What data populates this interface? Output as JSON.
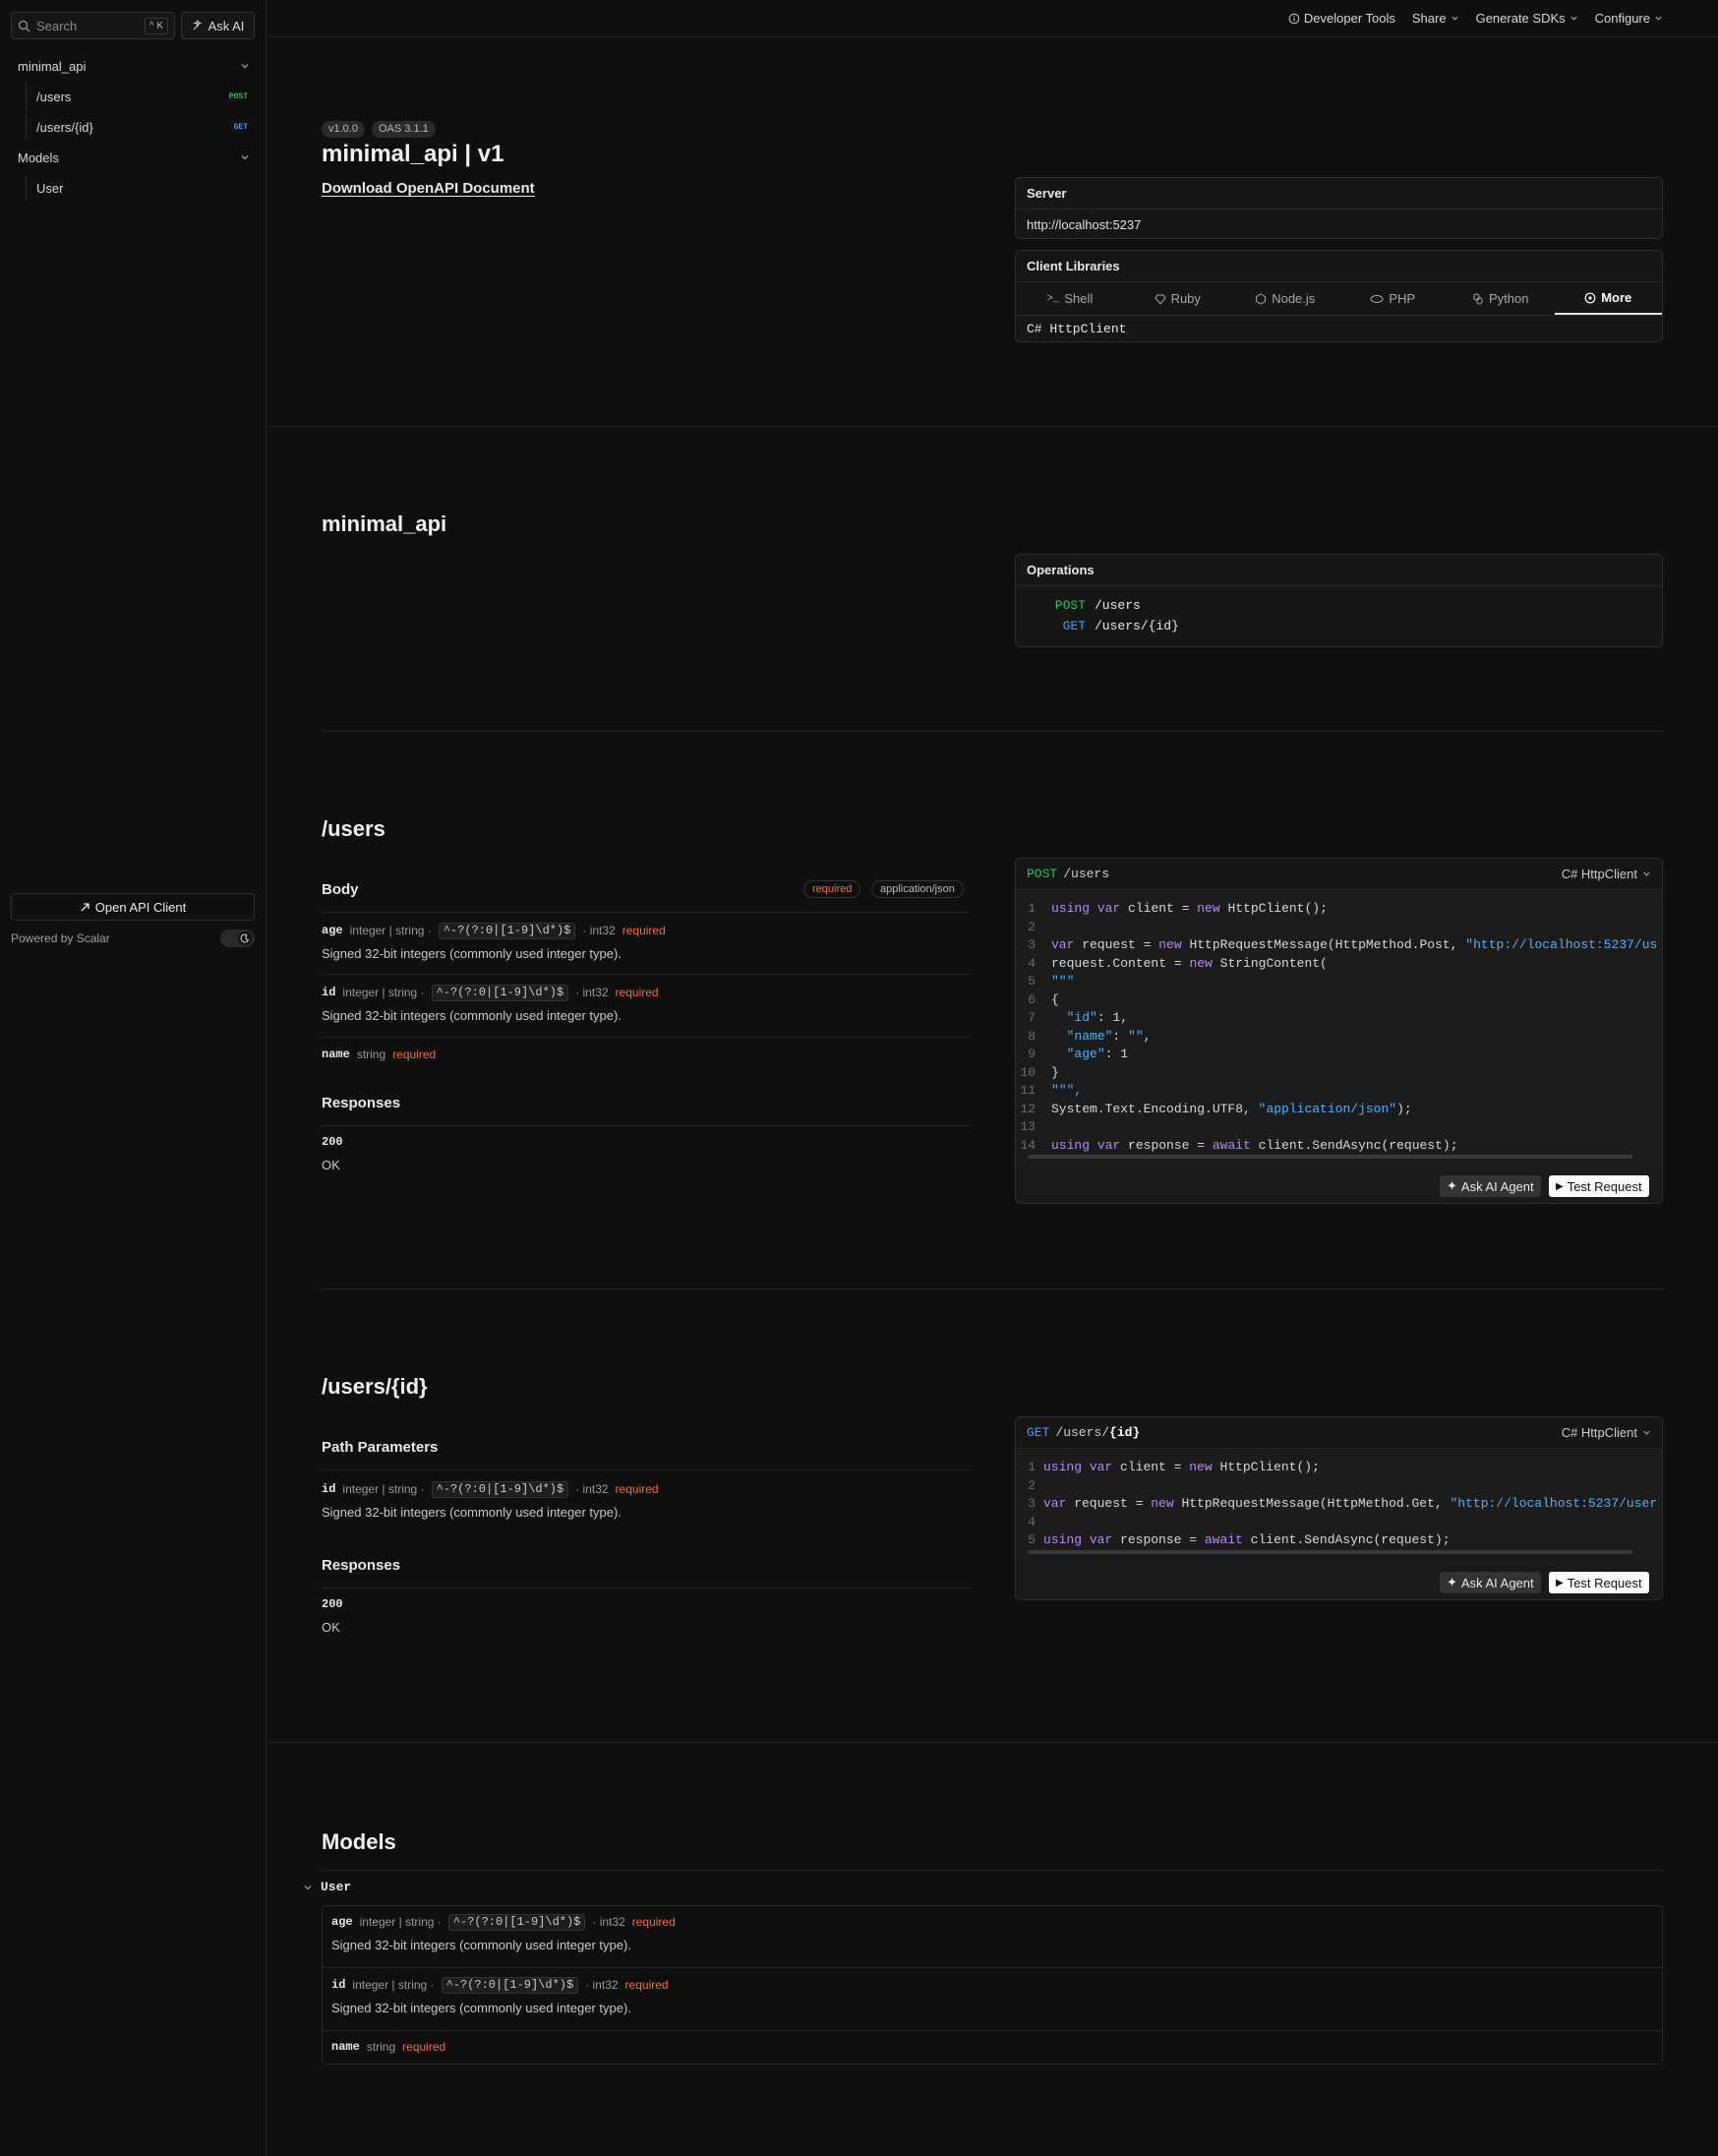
{
  "sidebar": {
    "search_placeholder": "Search",
    "search_kbd": "^ K",
    "ask_ai": "Ask AI",
    "groups": [
      {
        "label": "minimal_api"
      },
      {
        "label": "Models"
      }
    ],
    "items": [
      {
        "label": "/users",
        "method": "POST"
      },
      {
        "label": "/users/{id}",
        "method": "GET"
      },
      {
        "label": "User"
      }
    ],
    "open_client": "Open API Client",
    "powered_by": "Powered by Scalar"
  },
  "topbar": {
    "developer_tools": "Developer Tools",
    "share": "Share",
    "generate_sdks": "Generate SDKs",
    "configure": "Configure"
  },
  "intro": {
    "version_badge": "v1.0.0",
    "oas_badge": "OAS 3.1.1",
    "title": "minimal_api | v1",
    "download_link": "Download OpenAPI Document",
    "server_label": "Server",
    "server_url": "http://localhost:5237",
    "client_libraries_label": "Client Libraries",
    "client_tabs": [
      "Shell",
      "Ruby",
      "Node.js",
      "PHP",
      "Python",
      "More"
    ],
    "selected_client": "C# HttpClient"
  },
  "tag_section": {
    "title": "minimal_api",
    "operations_label": "Operations",
    "operations": [
      {
        "method": "POST",
        "path": "/users"
      },
      {
        "method": "GET",
        "path": "/users/{id}"
      }
    ]
  },
  "post_users": {
    "title": "/users",
    "body_label": "Body",
    "body_required": "required",
    "content_type": "application/json",
    "params": [
      {
        "name": "age",
        "type": "integer | string ·",
        "pattern": "^-?(?:0|[1-9]\\d*)$",
        "format": "· int32",
        "required": "required",
        "description": "Signed 32-bit integers (commonly used integer type)."
      },
      {
        "name": "id",
        "type": "integer | string ·",
        "pattern": "^-?(?:0|[1-9]\\d*)$",
        "format": "· int32",
        "required": "required",
        "description": "Signed 32-bit integers (commonly used integer type)."
      },
      {
        "name": "name",
        "type": "string",
        "required": "required"
      }
    ],
    "responses_label": "Responses",
    "response_code": "200",
    "response_text": "OK",
    "code_method": "POST",
    "code_path": "/users",
    "code_client": "C# HttpClient",
    "code_lines": [
      "using var client = new HttpClient();",
      "",
      "var request = new HttpRequestMessage(HttpMethod.Post, \"http://localhost:5237/us",
      "request.Content = new StringContent(",
      "\"\"\"",
      "{",
      "  \"id\": 1,",
      "  \"name\": \"\",",
      "  \"age\": 1",
      "}",
      "\"\"\",",
      "System.Text.Encoding.UTF8, \"application/json\");",
      "",
      "using var response = await client.SendAsync(request);"
    ],
    "ask_agent": "Ask AI Agent",
    "test_request": "Test Request"
  },
  "get_user": {
    "title": "/users/{id}",
    "path_params_label": "Path Parameters",
    "params": [
      {
        "name": "id",
        "type": "integer | string ·",
        "pattern": "^-?(?:0|[1-9]\\d*)$",
        "format": "· int32",
        "required": "required",
        "description": "Signed 32-bit integers (commonly used integer type)."
      }
    ],
    "responses_label": "Responses",
    "response_code": "200",
    "response_text": "OK",
    "code_method": "GET",
    "code_path_prefix": "/users/",
    "code_path_param": "{id}",
    "code_client": "C# HttpClient",
    "code_lines": [
      "using var client = new HttpClient();",
      "",
      "var request = new HttpRequestMessage(HttpMethod.Get, \"http://localhost:5237/user",
      "",
      "using var response = await client.SendAsync(request);"
    ],
    "ask_agent": "Ask AI Agent",
    "test_request": "Test Request"
  },
  "models": {
    "title": "Models",
    "model_name": "User",
    "params": [
      {
        "name": "age",
        "type": "integer | string ·",
        "pattern": "^-?(?:0|[1-9]\\d*)$",
        "format": "· int32",
        "required": "required",
        "description": "Signed 32-bit integers (commonly used integer type)."
      },
      {
        "name": "id",
        "type": "integer | string ·",
        "pattern": "^-?(?:0|[1-9]\\d*)$",
        "format": "· int32",
        "required": "required",
        "description": "Signed 32-bit integers (commonly used integer type)."
      },
      {
        "name": "name",
        "type": "string",
        "required": "required"
      }
    ]
  },
  "colors": {
    "post": "#22c55e",
    "get": "#3b9eff",
    "required": "#f26d3d",
    "keyword": "#b48cf2",
    "string": "#4fb3ff"
  }
}
